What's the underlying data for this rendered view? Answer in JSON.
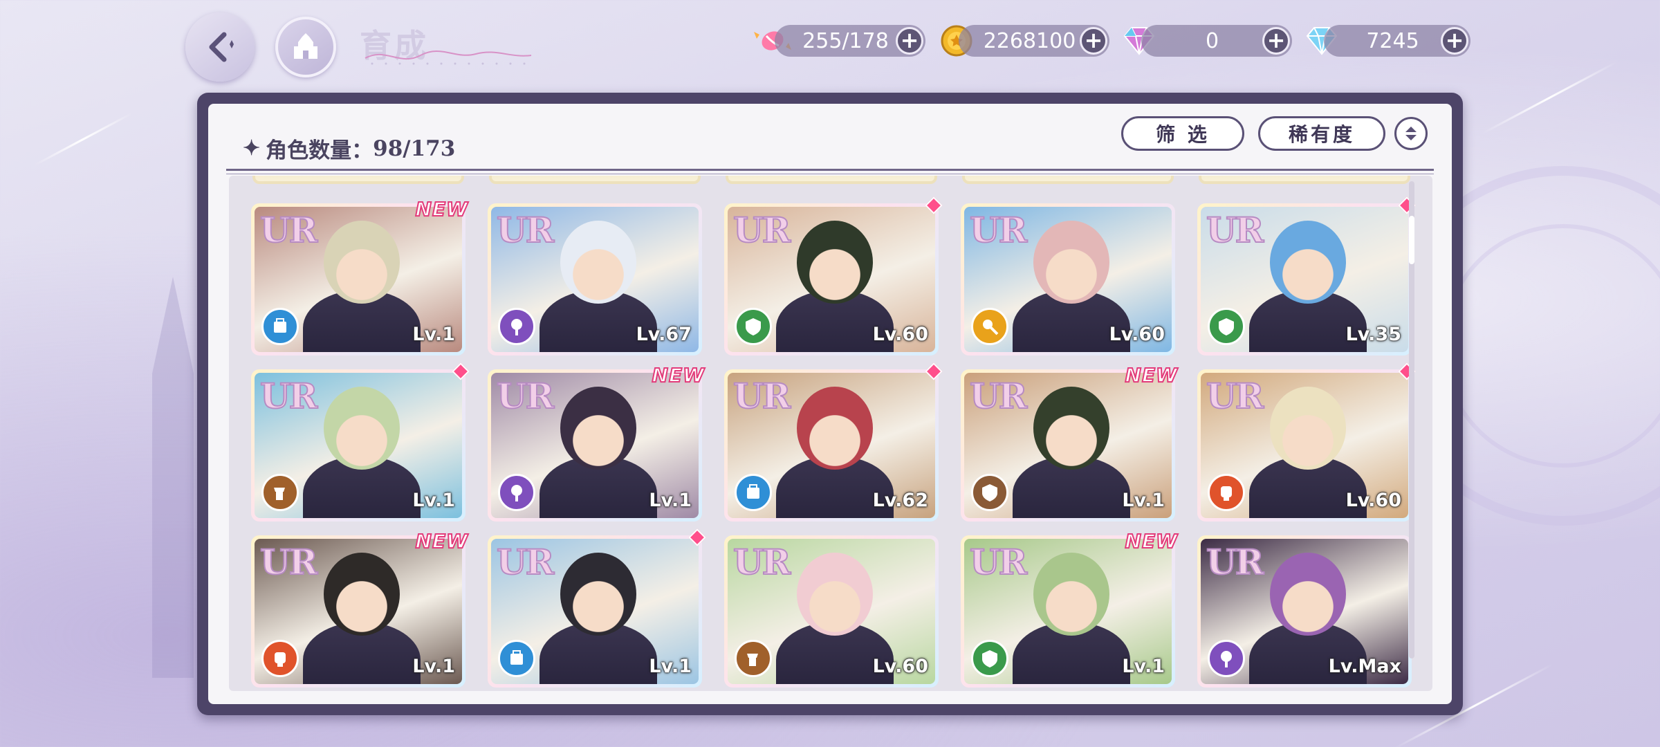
{
  "header": {
    "title": "育成",
    "back_icon": "back-arrow-icon",
    "home_icon": "castle-home-icon"
  },
  "resources": [
    {
      "name": "stamina",
      "icon": "candy-icon",
      "value": "255/178"
    },
    {
      "name": "gold",
      "icon": "gold-coin-icon",
      "value": "2268100"
    },
    {
      "name": "paid-gem",
      "icon": "purple-gem-icon",
      "value": "0"
    },
    {
      "name": "gem",
      "icon": "blue-diamond-icon",
      "value": "7245"
    }
  ],
  "panel": {
    "count_label": "角色数量：",
    "count_value": "98/173",
    "filter_label": "筛 选",
    "sort_label": "稀有度",
    "sort_icon": "sort-toggle-icon"
  },
  "cards": [
    {
      "rarity": "UR",
      "level": "Lv.1",
      "badge": "NEW",
      "type_color": "#2f8fd6",
      "hair": "#d9d3b6",
      "bg": "#b98a7f"
    },
    {
      "rarity": "UR",
      "level": "Lv.67",
      "badge": "",
      "type_color": "#7f4fbd",
      "hair": "#e7ecf4",
      "bg": "#8fb8e6"
    },
    {
      "rarity": "UR",
      "level": "Lv.60",
      "badge": "diamond",
      "type_color": "#3a9a4b",
      "hair": "#2f3a2a",
      "bg": "#d8b49a"
    },
    {
      "rarity": "UR",
      "level": "Lv.60",
      "badge": "",
      "type_color": "#e9a21b",
      "hair": "#e3b7b7",
      "bg": "#7fb7e4"
    },
    {
      "rarity": "UR",
      "level": "Lv.35",
      "badge": "diamond",
      "type_color": "#3a9a4b",
      "hair": "#69a9e0",
      "bg": "#c9dce9"
    },
    {
      "rarity": "UR",
      "level": "Lv.1",
      "badge": "diamond",
      "type_color": "#a0602b",
      "hair": "#c3d6a7",
      "bg": "#7cc0de"
    },
    {
      "rarity": "UR",
      "level": "Lv.1",
      "badge": "NEW",
      "type_color": "#7f4fbd",
      "hair": "#3b2f44",
      "bg": "#9f8aa6"
    },
    {
      "rarity": "UR",
      "level": "Lv.62",
      "badge": "diamond",
      "type_color": "#2f8fd6",
      "hair": "#b8434d",
      "bg": "#c7a27e"
    },
    {
      "rarity": "UR",
      "level": "Lv.1",
      "badge": "NEW",
      "type_color": "#8a5a36",
      "hair": "#34402c",
      "bg": "#caa07b"
    },
    {
      "rarity": "UR",
      "level": "Lv.60",
      "badge": "diamond",
      "type_color": "#e0532b",
      "hair": "#ece1c0",
      "bg": "#d2a97d"
    },
    {
      "rarity": "UR",
      "level": "Lv.1",
      "badge": "NEW",
      "type_color": "#e0532b",
      "hair": "#2e2a28",
      "bg": "#6c5a52"
    },
    {
      "rarity": "UR",
      "level": "Lv.1",
      "badge": "diamond",
      "type_color": "#2f8fd6",
      "hair": "#2d2b33",
      "bg": "#9cc5e3"
    },
    {
      "rarity": "UR",
      "level": "Lv.60",
      "badge": "",
      "type_color": "#a0602b",
      "hair": "#f1ccd2",
      "bg": "#b8d7a0"
    },
    {
      "rarity": "UR",
      "level": "Lv.1",
      "badge": "NEW",
      "type_color": "#3a9a4b",
      "hair": "#a9c68c",
      "bg": "#a7c98a"
    },
    {
      "rarity": "UR",
      "level": "Lv.Max",
      "badge": "",
      "type_color": "#7f4fbd",
      "hair": "#9a64b2",
      "bg": "#3c2b45"
    }
  ]
}
